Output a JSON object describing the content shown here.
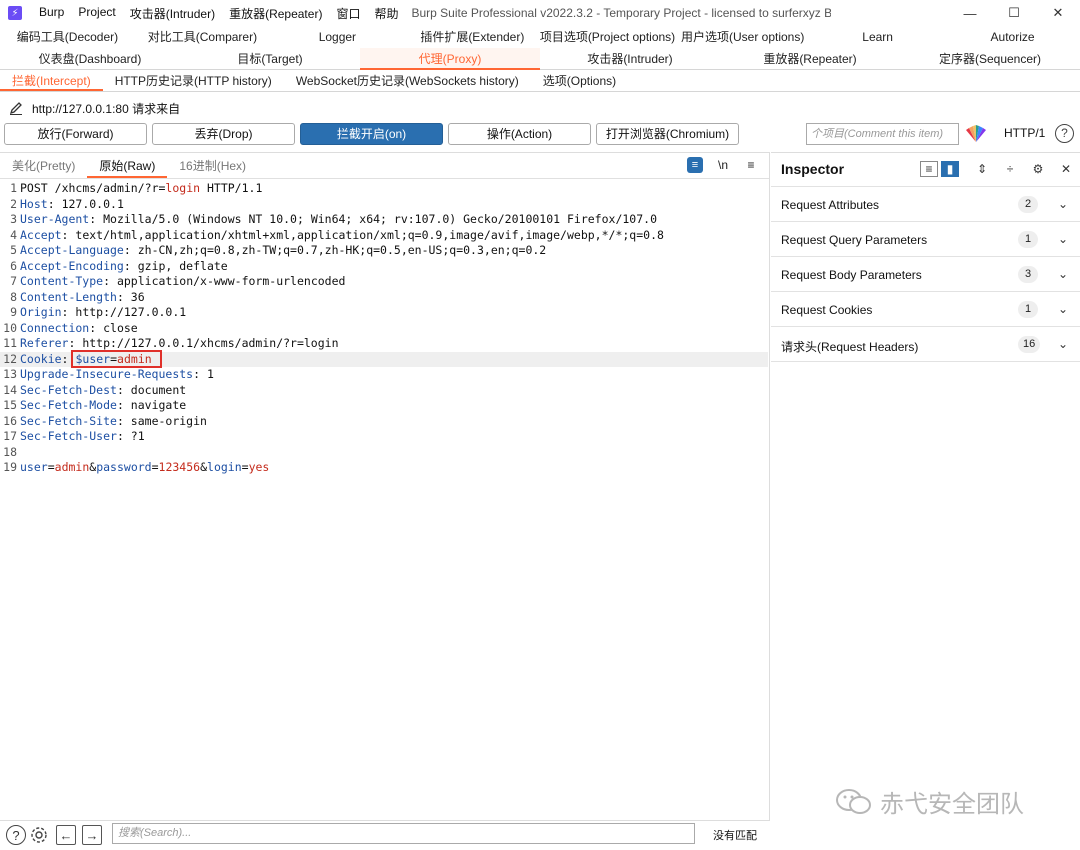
{
  "titlebar": {
    "app_icon": "burp-logo-icon",
    "menu": [
      "Burp",
      "Project",
      "攻击器(Intruder)",
      "重放器(Repeater)",
      "窗口",
      "帮助"
    ],
    "title": "Burp Suite Professional v2022.3.2 - Temporary Project - licensed to surferxyz By LianZhang.org By LianZhang...",
    "minimize": "—",
    "maximize": "☐",
    "close": "✕"
  },
  "tooltabs": {
    "row1": [
      "编码工具(Decoder)",
      "对比工具(Comparer)",
      "Logger",
      "插件扩展(Extender)",
      "项目选项(Project options)",
      "用户选项(User options)",
      "Learn",
      "Autorize"
    ],
    "row2": [
      "仪表盘(Dashboard)",
      "目标(Target)",
      "代理(Proxy)",
      "攻击器(Intruder)",
      "重放器(Repeater)",
      "定序器(Sequencer)"
    ],
    "active": "代理(Proxy)"
  },
  "subtabs": {
    "items": [
      "拦截(Intercept)",
      "HTTP历史记录(HTTP history)",
      "WebSocket历史记录(WebSockets history)",
      "选项(Options)"
    ],
    "active": "拦截(Intercept)"
  },
  "url_row": {
    "icon": "pencil-icon",
    "text": "http://127.0.0.1:80 请求来自"
  },
  "actions": {
    "forward": "放行(Forward)",
    "drop": "丢弃(Drop)",
    "intercept": "拦截开启(on)",
    "action": "操作(Action)",
    "browser": "打开浏览器(Chromium)",
    "comment_placeholder": "个项目(Comment this item)",
    "http_version": "HTTP/1",
    "help": "?"
  },
  "view_tabs": {
    "items": [
      "美化(Pretty)",
      "原始(Raw)",
      "16进制(Hex)"
    ],
    "active": "原始(Raw)",
    "newline_label": "\\n",
    "menu_label": "≡"
  },
  "request": {
    "request_line": {
      "method": "POST",
      "path": "/xhcms/admin/?r=",
      "param": "login",
      "version": "HTTP/1.1"
    },
    "headers": [
      {
        "n": "2",
        "name": "Host",
        "value": " 127.0.0.1"
      },
      {
        "n": "3",
        "name": "User-Agent",
        "value": " Mozilla/5.0 (Windows NT 10.0; Win64; x64; rv:107.0) Gecko/20100101 Firefox/107.0"
      },
      {
        "n": "4",
        "name": "Accept",
        "value": " text/html,application/xhtml+xml,application/xml;q=0.9,image/avif,image/webp,*/*;q=0.8"
      },
      {
        "n": "5",
        "name": "Accept-Language",
        "value": " zh-CN,zh;q=0.8,zh-TW;q=0.7,zh-HK;q=0.5,en-US;q=0.3,en;q=0.2"
      },
      {
        "n": "6",
        "name": "Accept-Encoding",
        "value": " gzip, deflate"
      },
      {
        "n": "7",
        "name": "Content-Type",
        "value": " application/x-www-form-urlencoded"
      },
      {
        "n": "8",
        "name": "Content-Length",
        "value": " 36"
      },
      {
        "n": "9",
        "name": "Origin",
        "value": " http://127.0.0.1"
      },
      {
        "n": "10",
        "name": "Connection",
        "value": " close"
      },
      {
        "n": "11",
        "name": "Referer",
        "value": " http://127.0.0.1/xhcms/admin/?r=login"
      }
    ],
    "cookie": {
      "n": "12",
      "name": "Cookie",
      "key": "$user",
      "value": "admin"
    },
    "headers2": [
      {
        "n": "13",
        "name": "Upgrade-Insecure-Requests",
        "value": " 1"
      },
      {
        "n": "14",
        "name": "Sec-Fetch-Dest",
        "value": " document"
      },
      {
        "n": "15",
        "name": "Sec-Fetch-Mode",
        "value": " navigate"
      },
      {
        "n": "16",
        "name": "Sec-Fetch-Site",
        "value": " same-origin"
      },
      {
        "n": "17",
        "name": "Sec-Fetch-User",
        "value": " ?1"
      }
    ],
    "blank_line_no": "18",
    "body_line_no": "19",
    "body": [
      {
        "k": "user",
        "v": "admin"
      },
      {
        "k": "password",
        "v": "123456"
      },
      {
        "k": "login",
        "v": "yes"
      }
    ]
  },
  "searchbar": {
    "placeholder": "搜索(Search)...",
    "status": "没有匹配"
  },
  "inspector": {
    "title": "Inspector",
    "sections": [
      {
        "label": "Request Attributes",
        "count": "2"
      },
      {
        "label": "Request Query Parameters",
        "count": "1"
      },
      {
        "label": "Request Body Parameters",
        "count": "3"
      },
      {
        "label": "Request Cookies",
        "count": "1"
      },
      {
        "label": "请求头(Request Headers)",
        "count": "16"
      }
    ]
  },
  "watermark": {
    "text": "赤弋安全团队",
    "icon": "wechat-icon"
  },
  "colors": {
    "accent": "#ff6633",
    "primary_button": "#2a6fb0",
    "header_name": "#1d4fa3",
    "param_value": "#c42b1c",
    "highlight_box": "#e0302a"
  }
}
